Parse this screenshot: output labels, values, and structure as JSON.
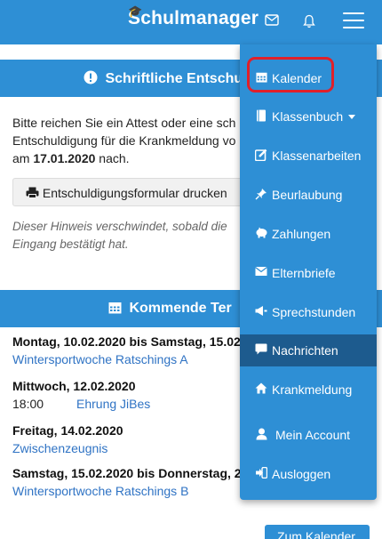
{
  "navbar": {
    "brand": "Schulmanager",
    "brand_hat": "🎓",
    "mail_icon": "envelope-icon",
    "bell_icon": "bell-icon",
    "menu_icon": "hamburger-icon"
  },
  "notice_panel": {
    "title": "Schriftliche Entschu",
    "icon": "exclamation-circle-icon",
    "text_line1": "Bitte reichen Sie ein Attest oder eine sch",
    "text_line2": "Entschuldigung für die Krankmeldung vo",
    "text_line3_prefix": "am ",
    "text_line3_date": "17.01.2020",
    "text_line3_suffix": " nach.",
    "button_label": "Entschuldigungsformular drucken",
    "hint_line1": "Dieser Hinweis verschwindet, sobald die",
    "hint_line2": "Eingang bestätigt hat."
  },
  "events_panel": {
    "title": "Kommende Ter",
    "icon": "calendar-icon",
    "events": [
      {
        "date": "Montag, 10.02.2020 bis Samstag, 15.02",
        "time": "",
        "title": "Wintersportwoche Ratschings A"
      },
      {
        "date": "Mittwoch, 12.02.2020",
        "time": "18:00",
        "title": "Ehrung JiBes"
      },
      {
        "date": "Freitag, 14.02.2020",
        "time": "",
        "title": "Zwischenzeugnis"
      },
      {
        "date": "Samstag, 15.02.2020 bis Donnerstag, 2",
        "time": "",
        "title": "Wintersportwoche Ratschings B"
      }
    ],
    "calendar_button": "Zum Kalender"
  },
  "menu": {
    "items": [
      {
        "label": "Kalender",
        "icon": "calendar-icon"
      },
      {
        "label": "Klassenbuch",
        "icon": "book-icon"
      },
      {
        "label": "Klassenarbeiten",
        "icon": "edit-icon"
      },
      {
        "label": "Beurlaubung",
        "icon": "pin-icon"
      },
      {
        "label": "Zahlungen",
        "icon": "piggy-bank-icon"
      },
      {
        "label": "Elternbriefe",
        "icon": "envelope-icon"
      },
      {
        "label": "Sprechstunden",
        "icon": "megaphone-icon"
      },
      {
        "label": "Nachrichten",
        "icon": "comment-icon"
      },
      {
        "label": "Krankmeldung",
        "icon": "home-icon"
      },
      {
        "label": "Mein Account",
        "icon": "user-icon"
      },
      {
        "label": "Ausloggen",
        "icon": "logout-icon"
      }
    ],
    "active_index": 7,
    "highlight_color": "#e0202a",
    "accent_color": "#2e8fd5"
  }
}
